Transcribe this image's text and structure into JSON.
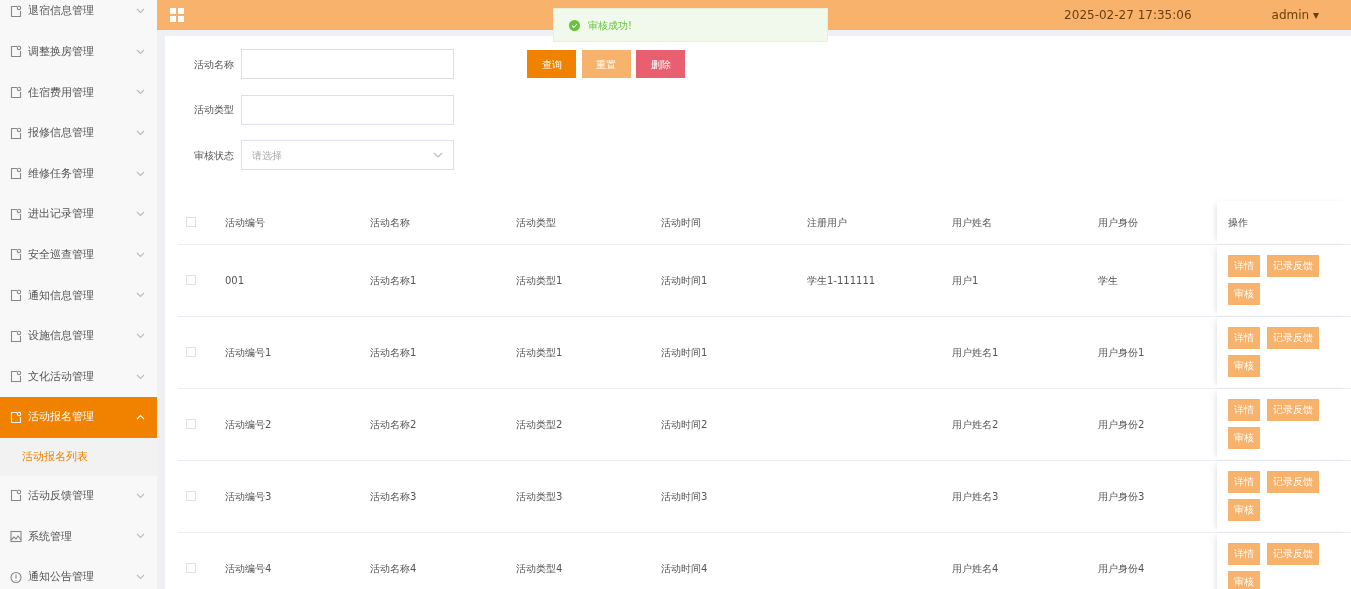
{
  "header": {
    "datetime": "2025-02-27 17:35:06",
    "user": "admin",
    "user_caret": "▾"
  },
  "toast": {
    "message": "审核成功!"
  },
  "sidebar": {
    "items": [
      {
        "label": "退宿信息管理",
        "expanded": false,
        "selected": false
      },
      {
        "label": "调整换房管理",
        "expanded": false,
        "selected": false
      },
      {
        "label": "住宿费用管理",
        "expanded": false,
        "selected": false
      },
      {
        "label": "报修信息管理",
        "expanded": false,
        "selected": false
      },
      {
        "label": "维修任务管理",
        "expanded": false,
        "selected": false
      },
      {
        "label": "进出记录管理",
        "expanded": false,
        "selected": false
      },
      {
        "label": "安全巡查管理",
        "expanded": false,
        "selected": false
      },
      {
        "label": "通知信息管理",
        "expanded": false,
        "selected": false
      },
      {
        "label": "设施信息管理",
        "expanded": false,
        "selected": false
      },
      {
        "label": "文化活动管理",
        "expanded": false,
        "selected": false
      },
      {
        "label": "活动报名管理",
        "expanded": true,
        "selected": true,
        "children": [
          {
            "label": "活动报名列表",
            "selected": true
          }
        ]
      },
      {
        "label": "活动反馈管理",
        "expanded": false,
        "selected": false
      },
      {
        "label": "系统管理",
        "expanded": false,
        "selected": false
      },
      {
        "label": "通知公告管理",
        "expanded": false,
        "selected": false
      }
    ]
  },
  "filters": [
    {
      "kind": "text",
      "label": "活动名称"
    },
    {
      "kind": "text",
      "label": "活动类型"
    },
    {
      "kind": "select",
      "label": "审核状态",
      "placeholder": "请选择"
    }
  ],
  "buttons": [
    {
      "label": "查询",
      "color": "#f08200"
    },
    {
      "label": "重置",
      "color": "#f7b26c"
    },
    {
      "label": "删除",
      "color": "#e8606f"
    }
  ],
  "table": {
    "all_checked": false,
    "columns": [
      "活动编号",
      "活动名称",
      "活动类型",
      "活动时间",
      "注册用户",
      "用户姓名",
      "用户身份",
      "操作"
    ],
    "rows": [
      {
        "checked": false,
        "cells": [
          "001",
          "活动名称1",
          "活动类型1",
          "活动时间1",
          "学生1-111111",
          "用户1",
          "学生"
        ],
        "actions": [
          "详情",
          "记录反馈",
          "审核"
        ]
      },
      {
        "checked": false,
        "cells": [
          "活动编号1",
          "活动名称1",
          "活动类型1",
          "活动时间1",
          "",
          "用户姓名1",
          "用户身份1"
        ],
        "actions": [
          "详情",
          "记录反馈",
          "审核"
        ]
      },
      {
        "checked": false,
        "cells": [
          "活动编号2",
          "活动名称2",
          "活动类型2",
          "活动时间2",
          "",
          "用户姓名2",
          "用户身份2"
        ],
        "actions": [
          "详情",
          "记录反馈",
          "审核"
        ]
      },
      {
        "checked": false,
        "cells": [
          "活动编号3",
          "活动名称3",
          "活动类型3",
          "活动时间3",
          "",
          "用户姓名3",
          "用户身份3"
        ],
        "actions": [
          "详情",
          "记录反馈",
          "审核"
        ]
      },
      {
        "checked": false,
        "cells": [
          "活动编号4",
          "活动名称4",
          "活动类型4",
          "活动时间4",
          "",
          "用户姓名4",
          "用户身份4"
        ],
        "actions": [
          "详情",
          "记录反馈",
          "审核"
        ]
      }
    ]
  }
}
